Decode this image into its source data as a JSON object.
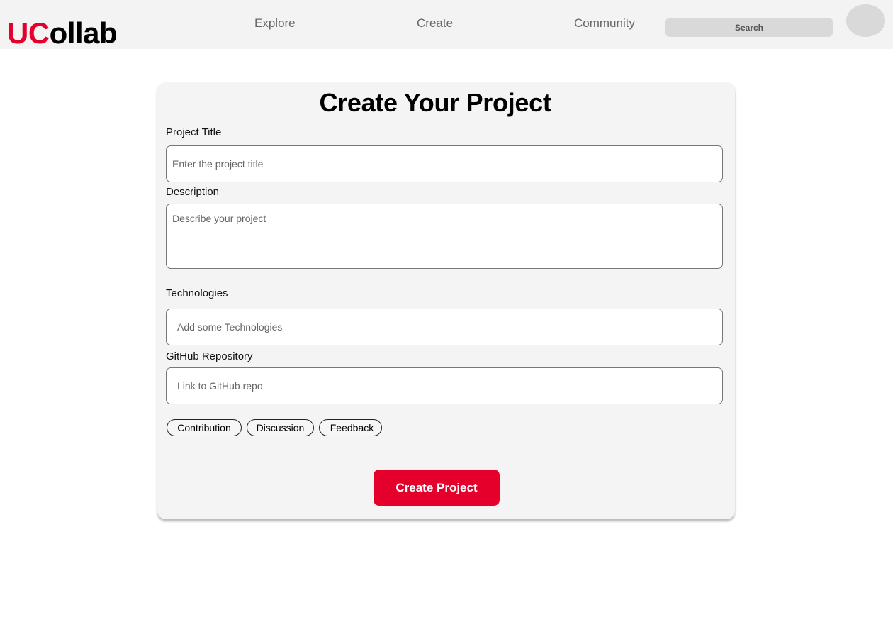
{
  "header": {
    "logo_accent": "UC",
    "logo_rest": "ollab",
    "nav": [
      "Explore",
      "Create",
      "Community"
    ],
    "search_placeholder": "Search"
  },
  "form": {
    "title": "Create Your Project",
    "fields": [
      {
        "label": "Project Title",
        "placeholder": "Enter the project title"
      },
      {
        "label": "Description",
        "placeholder": "Describe your project"
      },
      {
        "label": "Technologies",
        "placeholder": "Add some Technologies"
      },
      {
        "label": "GitHub Repository",
        "placeholder": "Link to GitHub repo"
      }
    ],
    "tags": [
      "Contribution",
      "Discussion",
      "Feedback"
    ],
    "submit_label": "Create Project"
  },
  "colors": {
    "brand_red": "#e4002b",
    "header_bg": "#f3f3f3",
    "card_bg": "#f4f4f4"
  }
}
